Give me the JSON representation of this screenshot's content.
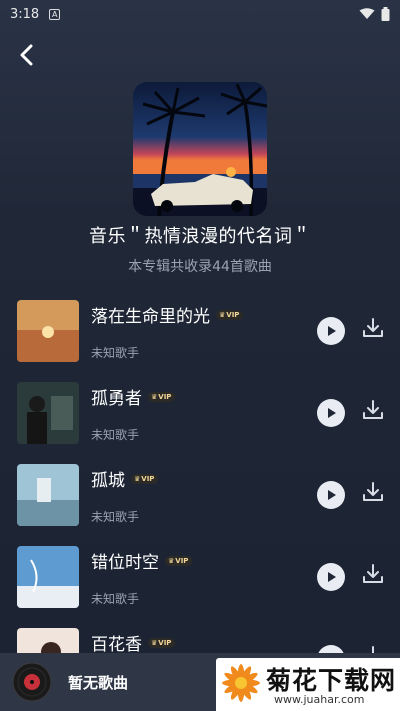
{
  "status_bar": {
    "time": "3:18",
    "app_badge": "A",
    "icons": [
      "wifi-icon",
      "battery-icon"
    ]
  },
  "header": {
    "back_icon": "chevron-left-icon"
  },
  "album": {
    "title": "音乐＂热情浪漫的代名词＂",
    "subtitle": "本专辑共收录44首歌曲"
  },
  "vip_label": "VIP",
  "songs": [
    {
      "title": "落在生命里的光",
      "artist": "未知歌手",
      "vip": true
    },
    {
      "title": "孤勇者",
      "artist": "未知歌手",
      "vip": true
    },
    {
      "title": "孤城",
      "artist": "未知歌手",
      "vip": true
    },
    {
      "title": "错位时空",
      "artist": "未知歌手",
      "vip": true
    },
    {
      "title": "百花香",
      "artist": "",
      "vip": true
    }
  ],
  "mini_player": {
    "now_playing": "暂无歌曲"
  },
  "watermark": {
    "name": "菊花下载网",
    "url": "www.juahar.com"
  },
  "colors": {
    "background_top": "#2a3346",
    "background_bottom": "#1b2232",
    "mini_player": "#2f3746",
    "secondary_text": "#9aa3b2",
    "vip_gold": "#f3d79a"
  }
}
